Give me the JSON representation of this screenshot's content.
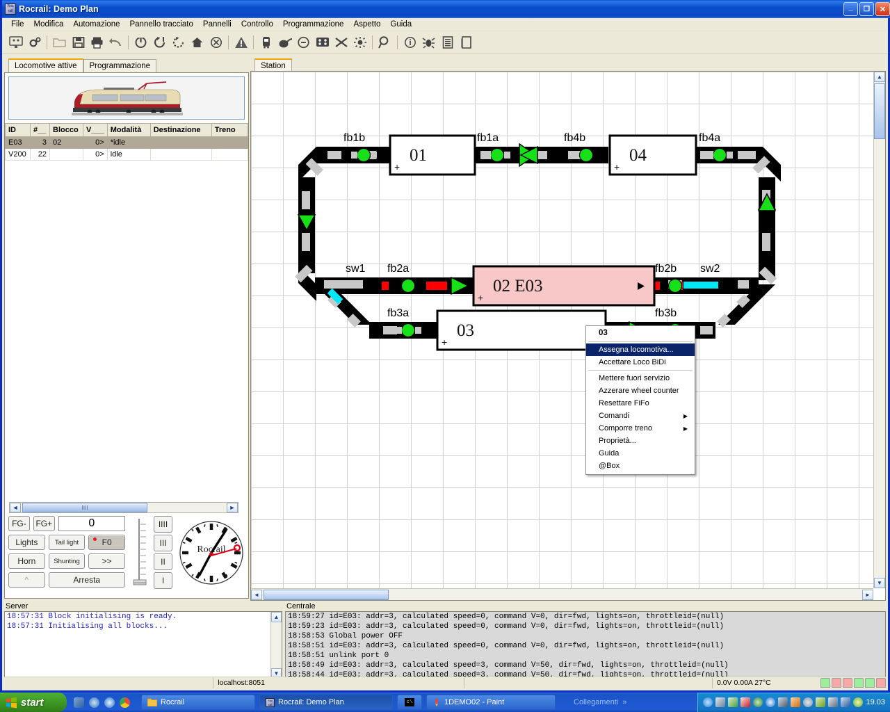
{
  "window": {
    "title": "Rocrail: Demo Plan",
    "icon": "rocrail-app-icon",
    "minimize": "_",
    "maximize": "❐",
    "close": "✕"
  },
  "menubar": {
    "items": [
      "File",
      "Modifica",
      "Automazione",
      "Pannello tracciato",
      "Pannelli",
      "Controllo",
      "Programmazione",
      "Aspetto",
      "Guida"
    ]
  },
  "toolbar": {
    "icons": [
      "monitor-icon",
      "gears-icon",
      "open-folder-icon",
      "save-icon",
      "print-icon",
      "undo-icon",
      "power-icon",
      "loop-run-icon",
      "loop-stop-icon",
      "home-icon",
      "cancel-icon",
      "warning-icon",
      "train-icon",
      "mouse-icon",
      "speed-dial-icon",
      "blocks-icon",
      "shuffle-icon",
      "light-bulb-icon",
      "magnifier-icon",
      "info-icon",
      "bug-icon",
      "list-icon",
      "book-icon"
    ]
  },
  "left_tabs": [
    {
      "label": "Locomotive attive",
      "active": true
    },
    {
      "label": "Programmazione",
      "active": false
    }
  ],
  "loco_image": {
    "name": "db-br103-tee-locomotive"
  },
  "loco_table": {
    "columns": [
      "ID",
      "#__",
      "Blocco",
      "V___",
      "Modalità",
      "Destinazione",
      "Treno"
    ],
    "rows": [
      {
        "id": "E03",
        "num": "3",
        "blocco": "02",
        "v": "0>",
        "modalita": "*idle",
        "destinazione": "",
        "treno": "",
        "selected": true
      },
      {
        "id": "V200",
        "num": "22",
        "blocco": "",
        "v": "0>",
        "modalita": "idle",
        "destinazione": "",
        "treno": "",
        "selected": false
      }
    ]
  },
  "throttle": {
    "speed_value": "0",
    "buttons": {
      "fg_minus": "FG-",
      "fg_plus": "FG+",
      "lights": "Lights",
      "tail_light": "Tail light",
      "f0": "F0",
      "horn": "Horn",
      "shunting": "Shunting",
      "forward": ">>",
      "up": "^",
      "stop": "Arresta"
    },
    "steps": [
      "IIII",
      "III",
      "II",
      "I"
    ],
    "clock_brand": "Rocrail"
  },
  "plan_tab": {
    "label": "Station"
  },
  "plan": {
    "blocks": [
      {
        "id": "01",
        "text": "01",
        "state": "free"
      },
      {
        "id": "04",
        "text": "04",
        "state": "free"
      },
      {
        "id": "02",
        "text": "02  E03",
        "state": "occupied",
        "color": "#f8c8c8"
      },
      {
        "id": "03",
        "text": "03",
        "state": "free"
      }
    ],
    "sensors": [
      "fb1b",
      "fb1a",
      "fb4b",
      "fb4a",
      "fb2a",
      "fb2b",
      "fb3a",
      "fb3b"
    ],
    "switches": [
      "sw1",
      "sw2"
    ],
    "colors": {
      "track": "#000000",
      "sensor_green": "#00e000",
      "signal_red": "#ff0000",
      "switch_cyan": "#00e8f8",
      "sleeper": "#c8c8c8",
      "occupied_block": "#f8c8c8"
    }
  },
  "context_menu": {
    "header": "03",
    "items": [
      {
        "label": "Assegna locomotiva...",
        "highlight": true,
        "submenu": false
      },
      {
        "label": "Accettare Loco BiDi",
        "highlight": false,
        "submenu": false
      },
      {
        "separator": true
      },
      {
        "label": "Mettere fuori servizio",
        "highlight": false,
        "submenu": false
      },
      {
        "label": "Azzerare wheel counter",
        "highlight": false,
        "submenu": false
      },
      {
        "label": "Resettare FiFo",
        "highlight": false,
        "submenu": false
      },
      {
        "label": "Comandi",
        "highlight": false,
        "submenu": true
      },
      {
        "label": "Comporre treno",
        "highlight": false,
        "submenu": true
      },
      {
        "label": "Proprietà...",
        "highlight": false,
        "submenu": false
      },
      {
        "label": "Guida",
        "highlight": false,
        "submenu": false
      },
      {
        "label": "@Box",
        "highlight": false,
        "submenu": false
      }
    ]
  },
  "server_log": {
    "caption": "Server",
    "lines": [
      "18:57:31 Block initialising is ready.",
      "18:57:31 Initialising all blocks..."
    ]
  },
  "central_log": {
    "caption": "Centrale",
    "lines": [
      "18:59:27 id=E03: addr=3, calculated speed=0, command V=0, dir=fwd, lights=on, throttleid=(null)",
      "18:59:23 id=E03: addr=3, calculated speed=0, command V=0, dir=fwd, lights=on, throttleid=(null)",
      "18:58:53 Global power OFF",
      "18:58:51 id=E03: addr=3, calculated speed=0, command V=0, dir=fwd, lights=on, throttleid=(null)",
      "18:58:51 unlink port 0",
      "18:58:49 id=E03: addr=3, calculated speed=3, command V=50, dir=fwd, lights=on, throttleid=(null)",
      "18:58:44 id=E03: addr=3, calculated speed=3, command V=50, dir=fwd, lights=on, throttleid=(null)"
    ]
  },
  "statusbar": {
    "connection": "localhost:8051",
    "power": "0.0V 0.00A 27°C",
    "leds": [
      "#9cf09c",
      "#f8a8a8",
      "#f8a8a8",
      "#9cf09c",
      "#9cf09c",
      "#f8a8a8"
    ]
  },
  "taskbar": {
    "start": "start",
    "quick_icons": [
      "media-player-icon",
      "windows-media-icon",
      "internet-explorer-icon",
      "chrome-icon"
    ],
    "items": [
      {
        "label": "Rocrail",
        "icon": "folder-icon"
      },
      {
        "label": "Rocrail: Demo Plan",
        "icon": "rocrail-app-icon"
      },
      {
        "label": "",
        "icon": "console-icon"
      },
      {
        "label": "1DEMO02 - Paint",
        "icon": "paint-icon"
      }
    ],
    "links_label": "Collegamenti",
    "links_chevron": "»",
    "clock": "19.03",
    "tray_icons": [
      "magnifier-icon",
      "tool-icon",
      "shield-icon",
      "antivirus-icon",
      "net-icon",
      "sync-icon",
      "network-icon",
      "volume-icon",
      "disc-icon",
      "pen-icon",
      "plug-icon",
      "monitor-icon",
      "update-icon"
    ]
  }
}
